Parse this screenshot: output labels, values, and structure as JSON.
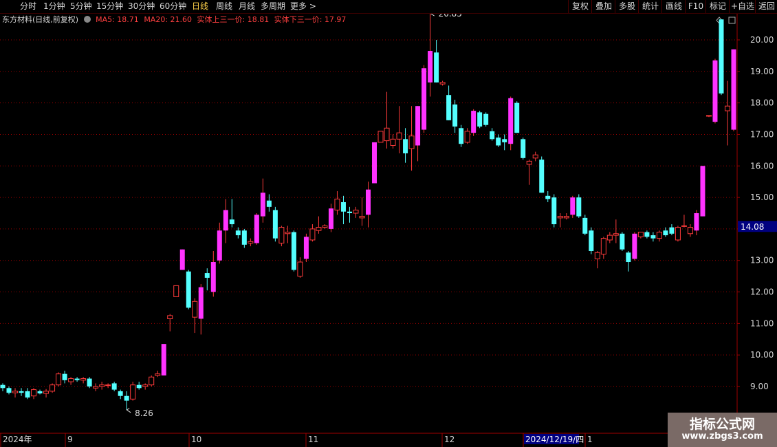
{
  "toolbar": {
    "periods": [
      "分时",
      "1分钟",
      "5分钟",
      "15分钟",
      "30分钟",
      "60分钟",
      "日线",
      "周线",
      "月线",
      "多周期",
      "更多 >"
    ],
    "active_period": "日线",
    "right_buttons": [
      "复权",
      "叠加",
      "多股",
      "统计",
      "画线",
      "F10",
      "标记",
      "+自选",
      "返回"
    ]
  },
  "info": {
    "stock_label": "东方材料(日线,前复权)",
    "ma5": "MA5: 18.71",
    "ma20": "MA20: 21.60",
    "upper_label": "实体上三一价: 18.81",
    "lower_label": "实体下三一价: 17.97"
  },
  "price_axis": {
    "ticks": [
      "20.00",
      "19.00",
      "18.00",
      "17.00",
      "16.00",
      "15.00",
      "14.00",
      "13.00",
      "12.00",
      "11.00",
      "10.00",
      "9.00"
    ],
    "current_price": "14.08"
  },
  "date_axis": {
    "labels": [
      "2024年",
      "9",
      "10",
      "11",
      "12",
      "2024/12/19/四",
      "1"
    ]
  },
  "annotations": {
    "high": "20.85",
    "low": "8.26"
  },
  "watermark": {
    "title": "指标公式网",
    "url": "www.zbgs3.com"
  },
  "colors": {
    "up": "#ff3b3b",
    "down": "#54ffff",
    "highlight_up": "#ff33ff",
    "special": "#ffd700",
    "grid": "#a00000",
    "axis_text": "#d8d8d8",
    "current_price_bg": "#000080"
  },
  "chart_data": {
    "type": "candlestick",
    "ylim": [
      8.0,
      21.2
    ],
    "series": [
      {
        "o": 9.05,
        "h": 9.1,
        "l": 8.85,
        "c": 8.95
      },
      {
        "o": 8.95,
        "h": 9.0,
        "l": 8.75,
        "c": 8.8
      },
      {
        "o": 8.8,
        "h": 8.95,
        "l": 8.65,
        "c": 8.85
      },
      {
        "o": 8.85,
        "h": 8.95,
        "l": 8.7,
        "c": 8.8
      },
      {
        "o": 8.85,
        "h": 8.95,
        "l": 8.6,
        "c": 8.65
      },
      {
        "o": 8.7,
        "h": 8.95,
        "l": 8.6,
        "c": 8.9
      },
      {
        "o": 8.85,
        "h": 8.9,
        "l": 8.75,
        "c": 8.78
      },
      {
        "o": 8.78,
        "h": 8.92,
        "l": 8.65,
        "c": 8.85
      },
      {
        "o": 8.85,
        "h": 9.1,
        "l": 8.8,
        "c": 9.05
      },
      {
        "o": 9.05,
        "h": 9.45,
        "l": 9.0,
        "c": 9.4
      },
      {
        "o": 9.4,
        "h": 9.5,
        "l": 9.1,
        "c": 9.2
      },
      {
        "o": 9.15,
        "h": 9.3,
        "l": 9.05,
        "c": 9.25
      },
      {
        "o": 9.25,
        "h": 9.3,
        "l": 9.15,
        "c": 9.2
      },
      {
        "o": 9.2,
        "h": 9.3,
        "l": 9.1,
        "c": 9.25
      },
      {
        "o": 9.25,
        "h": 9.3,
        "l": 8.95,
        "c": 9.0
      },
      {
        "o": 8.95,
        "h": 9.1,
        "l": 8.85,
        "c": 9.0
      },
      {
        "o": 9.0,
        "h": 9.15,
        "l": 8.9,
        "c": 9.05
      },
      {
        "o": 9.05,
        "h": 9.1,
        "l": 8.95,
        "c": 9.05
      },
      {
        "o": 9.1,
        "h": 9.15,
        "l": 8.85,
        "c": 8.9
      },
      {
        "o": 8.85,
        "h": 8.9,
        "l": 8.6,
        "c": 8.7
      },
      {
        "o": 8.7,
        "h": 8.85,
        "l": 8.26,
        "c": 8.55
      },
      {
        "o": 8.6,
        "h": 9.15,
        "l": 8.55,
        "c": 9.05
      },
      {
        "o": 9.05,
        "h": 9.15,
        "l": 8.9,
        "c": 8.95
      },
      {
        "o": 9.0,
        "h": 9.1,
        "l": 8.9,
        "c": 9.05
      },
      {
        "o": 9.05,
        "h": 9.35,
        "l": 9.0,
        "c": 9.3
      },
      {
        "o": 9.35,
        "h": 9.5,
        "l": 9.3,
        "c": 9.4
      },
      {
        "o": 9.35,
        "h": 10.35,
        "l": 9.35,
        "c": 10.35
      },
      {
        "o": 11.15,
        "h": 11.3,
        "l": 10.75,
        "c": 11.25
      },
      {
        "o": 11.85,
        "h": 12.2,
        "l": 11.85,
        "c": 12.2
      },
      {
        "o": 12.7,
        "h": 13.35,
        "l": 12.7,
        "c": 13.35
      },
      {
        "o": 12.65,
        "h": 12.7,
        "l": 11.45,
        "c": 11.5
      },
      {
        "o": 11.2,
        "h": 11.8,
        "l": 10.7,
        "c": 11.7
      },
      {
        "o": 11.15,
        "h": 12.25,
        "l": 10.65,
        "c": 12.15
      },
      {
        "o": 12.6,
        "h": 12.75,
        "l": 12.05,
        "c": 12.45
      },
      {
        "o": 12.0,
        "h": 13.3,
        "l": 11.85,
        "c": 12.95
      },
      {
        "o": 13.0,
        "h": 14.2,
        "l": 12.9,
        "c": 13.95
      },
      {
        "o": 13.95,
        "h": 14.95,
        "l": 13.55,
        "c": 14.6
      },
      {
        "o": 14.3,
        "h": 14.95,
        "l": 14.05,
        "c": 14.15
      },
      {
        "o": 13.95,
        "h": 14.05,
        "l": 13.7,
        "c": 13.8
      },
      {
        "o": 13.95,
        "h": 14.0,
        "l": 13.4,
        "c": 13.5
      },
      {
        "o": 13.55,
        "h": 13.7,
        "l": 13.45,
        "c": 13.6
      },
      {
        "o": 13.55,
        "h": 14.5,
        "l": 13.5,
        "c": 14.45
      },
      {
        "o": 14.4,
        "h": 15.6,
        "l": 14.2,
        "c": 15.15
      },
      {
        "o": 14.9,
        "h": 15.1,
        "l": 14.55,
        "c": 14.7
      },
      {
        "o": 14.6,
        "h": 14.7,
        "l": 13.6,
        "c": 13.7
      },
      {
        "o": 13.55,
        "h": 14.1,
        "l": 13.45,
        "c": 14.05
      },
      {
        "o": 13.85,
        "h": 14.1,
        "l": 13.55,
        "c": 13.9
      },
      {
        "o": 13.9,
        "h": 13.95,
        "l": 12.65,
        "c": 12.7
      },
      {
        "o": 12.5,
        "h": 13.1,
        "l": 12.45,
        "c": 12.95
      },
      {
        "o": 13.05,
        "h": 13.85,
        "l": 12.95,
        "c": 13.75
      },
      {
        "o": 13.65,
        "h": 14.15,
        "l": 13.6,
        "c": 14.0
      },
      {
        "o": 13.95,
        "h": 14.4,
        "l": 13.85,
        "c": 14.05
      },
      {
        "o": 14.05,
        "h": 14.15,
        "l": 14.0,
        "c": 14.1
      },
      {
        "o": 14.0,
        "h": 14.8,
        "l": 13.9,
        "c": 14.65
      },
      {
        "o": 14.6,
        "h": 15.2,
        "l": 14.45,
        "c": 14.95
      },
      {
        "o": 14.85,
        "h": 15.05,
        "l": 14.15,
        "c": 14.55
      },
      {
        "o": 14.55,
        "h": 14.7,
        "l": 14.2,
        "c": 14.5
      },
      {
        "o": 14.5,
        "h": 14.7,
        "l": 14.35,
        "c": 14.6
      },
      {
        "o": 14.35,
        "h": 15.0,
        "l": 14.1,
        "c": 14.4
      },
      {
        "o": 14.45,
        "h": 15.5,
        "l": 14.05,
        "c": 15.25
      },
      {
        "o": 15.45,
        "h": 16.75,
        "l": 15.45,
        "c": 16.75
      },
      {
        "o": 16.75,
        "h": 17.0,
        "l": 16.95,
        "c": 17.1
      },
      {
        "o": 16.8,
        "h": 18.35,
        "l": 16.55,
        "c": 17.2
      },
      {
        "o": 16.65,
        "h": 17.0,
        "l": 16.55,
        "c": 16.85
      },
      {
        "o": 16.85,
        "h": 17.9,
        "l": 16.4,
        "c": 17.05
      },
      {
        "o": 16.85,
        "h": 17.2,
        "l": 16.1,
        "c": 16.4
      },
      {
        "o": 16.55,
        "h": 17.9,
        "l": 15.85,
        "c": 16.95
      },
      {
        "o": 16.65,
        "h": 17.8,
        "l": 16.15,
        "c": 17.9
      },
      {
        "o": 17.15,
        "h": 19.2,
        "l": 17.05,
        "c": 19.1
      },
      {
        "o": 18.65,
        "h": 20.85,
        "l": 18.2,
        "c": 19.65
      },
      {
        "o": 19.6,
        "h": 20.0,
        "l": 18.7,
        "c": 18.65
      },
      {
        "o": 18.6,
        "h": 18.7,
        "l": 18.55,
        "c": 18.65
      },
      {
        "o": 18.25,
        "h": 18.55,
        "l": 17.5,
        "c": 17.45
      },
      {
        "o": 17.95,
        "h": 18.1,
        "l": 17.05,
        "c": 17.25
      },
      {
        "o": 17.2,
        "h": 17.3,
        "l": 16.6,
        "c": 16.7
      },
      {
        "o": 16.75,
        "h": 17.2,
        "l": 16.7,
        "c": 17.1
      },
      {
        "o": 17.05,
        "h": 17.8,
        "l": 16.95,
        "c": 17.75
      },
      {
        "o": 17.7,
        "h": 17.75,
        "l": 17.2,
        "c": 17.25
      },
      {
        "o": 17.65,
        "h": 17.7,
        "l": 17.25,
        "c": 17.3
      },
      {
        "o": 17.1,
        "h": 17.2,
        "l": 16.8,
        "c": 16.85
      },
      {
        "o": 16.9,
        "h": 17.0,
        "l": 16.6,
        "c": 16.65
      },
      {
        "o": 16.85,
        "h": 17.0,
        "l": 16.5,
        "c": 16.75
      },
      {
        "o": 16.7,
        "h": 18.2,
        "l": 16.5,
        "c": 18.15
      },
      {
        "o": 18.0,
        "h": 18.05,
        "l": 17.05,
        "c": 17.05
      },
      {
        "o": 16.85,
        "h": 16.9,
        "l": 16.2,
        "c": 16.25
      },
      {
        "o": 16.05,
        "h": 16.2,
        "l": 15.4,
        "c": 16.15
      },
      {
        "o": 16.25,
        "h": 16.45,
        "l": 16.15,
        "c": 16.35
      },
      {
        "o": 16.2,
        "h": 16.3,
        "l": 15.15,
        "c": 15.15
      },
      {
        "o": 15.05,
        "h": 15.2,
        "l": 14.85,
        "c": 14.95
      },
      {
        "o": 15.0,
        "h": 15.1,
        "l": 14.05,
        "c": 14.15
      },
      {
        "o": 14.35,
        "h": 14.5,
        "l": 14.05,
        "c": 14.4
      },
      {
        "o": 14.35,
        "h": 14.5,
        "l": 14.3,
        "c": 14.4
      },
      {
        "o": 14.45,
        "h": 15.05,
        "l": 14.35,
        "c": 15.0
      },
      {
        "o": 15.0,
        "h": 15.1,
        "l": 14.35,
        "c": 14.4
      },
      {
        "o": 14.35,
        "h": 14.45,
        "l": 13.8,
        "c": 13.85
      },
      {
        "o": 13.95,
        "h": 14.05,
        "l": 13.2,
        "c": 13.3
      },
      {
        "o": 13.05,
        "h": 13.3,
        "l": 12.75,
        "c": 13.25
      },
      {
        "o": 13.2,
        "h": 13.75,
        "l": 13.05,
        "c": 13.7
      },
      {
        "o": 13.65,
        "h": 13.9,
        "l": 13.55,
        "c": 13.8
      },
      {
        "o": 13.8,
        "h": 14.3,
        "l": 13.55,
        "c": 13.85
      },
      {
        "o": 13.85,
        "h": 13.9,
        "l": 13.3,
        "c": 13.35
      },
      {
        "o": 13.25,
        "h": 13.3,
        "l": 12.65,
        "c": 12.95
      },
      {
        "o": 13.05,
        "h": 13.9,
        "l": 13.0,
        "c": 13.85
      },
      {
        "o": 13.75,
        "h": 13.9,
        "l": 13.7,
        "c": 13.9
      },
      {
        "o": 13.9,
        "h": 13.95,
        "l": 13.7,
        "c": 13.75
      },
      {
        "o": 13.8,
        "h": 13.9,
        "l": 13.6,
        "c": 13.7
      },
      {
        "o": 13.7,
        "h": 13.95,
        "l": 13.6,
        "c": 13.9
      },
      {
        "o": 13.95,
        "h": 14.05,
        "l": 13.75,
        "c": 13.8
      },
      {
        "o": 14.05,
        "h": 14.15,
        "l": 13.8,
        "c": 13.85
      },
      {
        "o": 13.65,
        "h": 14.1,
        "l": 13.6,
        "c": 14.05
      },
      {
        "o": 14.1,
        "h": 14.45,
        "l": 14.05,
        "c": 14.1
      },
      {
        "o": 13.85,
        "h": 14.15,
        "l": 13.75,
        "c": 14.05
      },
      {
        "o": 13.95,
        "h": 14.6,
        "l": 13.8,
        "c": 14.5
      },
      {
        "o": 14.4,
        "h": 16.0,
        "l": 14.4,
        "c": 16.0
      },
      {
        "o": 17.6,
        "h": 17.6,
        "l": 17.55,
        "c": 17.6
      },
      {
        "o": 17.4,
        "h": 19.4,
        "l": 17.35,
        "c": 19.35
      },
      {
        "o": 20.65,
        "h": 20.65,
        "l": 18.25,
        "c": 18.3
      },
      {
        "o": 17.75,
        "h": 18.7,
        "l": 16.65,
        "c": 17.9
      },
      {
        "o": 17.15,
        "h": 19.7,
        "l": 17.1,
        "c": 19.7
      }
    ]
  }
}
